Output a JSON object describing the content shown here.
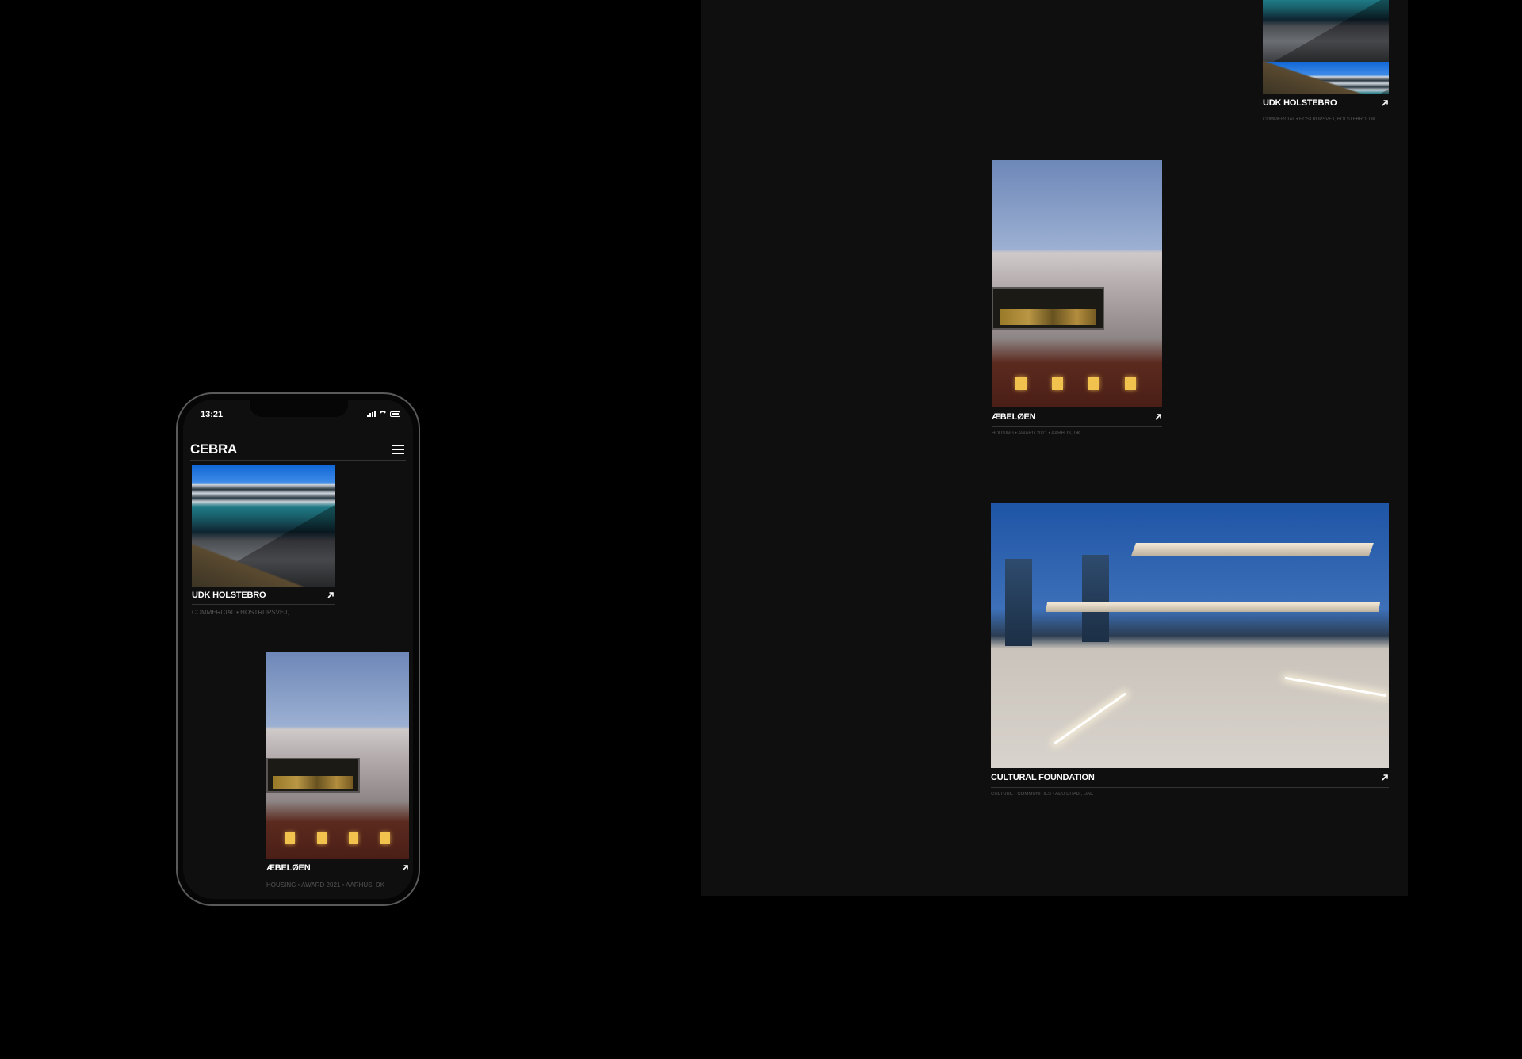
{
  "phone": {
    "status_time": "13:21",
    "brand": "CEBRA",
    "menu_icon": "hamburger-icon",
    "projects": [
      {
        "title": "UDK HOLSTEBRO",
        "meta": "COMMERCIAL • HOSTRUPSVEJ,...",
        "icon": "arrow-up-right-icon"
      },
      {
        "title": "ÆBELØEN",
        "meta": "HOUSING • AWARD 2021 • AARHUS, DK",
        "icon": "arrow-up-right-icon"
      }
    ]
  },
  "desktop": {
    "projects": [
      {
        "title": "UDK HOLSTEBRO",
        "meta": "COMMERCIAL • HOSTRUPSVEJ, HOLSTEBRO, DK",
        "icon": "arrow-up-right-icon"
      },
      {
        "title": "ÆBELØEN",
        "meta": "HOUSING • AWARD 2021 • AARHUS, DK",
        "icon": "arrow-up-right-icon"
      },
      {
        "title": "CULTURAL FOUNDATION",
        "meta": "CULTURE • COMMUNITIES • ABU DHABI, UAE",
        "icon": "arrow-up-right-icon"
      }
    ]
  }
}
